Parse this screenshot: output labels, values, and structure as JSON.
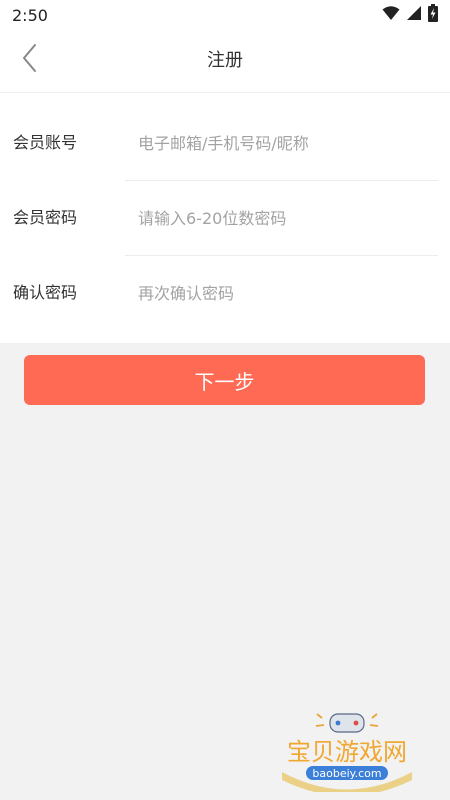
{
  "status_bar": {
    "time": "2:50",
    "icons": [
      "wifi-icon",
      "signal-icon",
      "battery-charging-icon"
    ]
  },
  "nav": {
    "title": "注册",
    "back_icon": "chevron-left-icon"
  },
  "form": {
    "fields": [
      {
        "label": "会员账号",
        "placeholder": "电子邮箱/手机号码/昵称",
        "value": ""
      },
      {
        "label": "会员密码",
        "placeholder": "请输入6-20位数密码",
        "value": ""
      },
      {
        "label": "确认密码",
        "placeholder": "再次确认密码",
        "value": ""
      }
    ]
  },
  "actions": {
    "next_label": "下一步"
  },
  "watermark": {
    "brand": "宝贝游戏网",
    "url": "baobeiy.com"
  },
  "colors": {
    "accent": "#ff6a55",
    "background": "#f2f2f2",
    "surface": "#ffffff",
    "placeholder": "#a3a3a3"
  }
}
